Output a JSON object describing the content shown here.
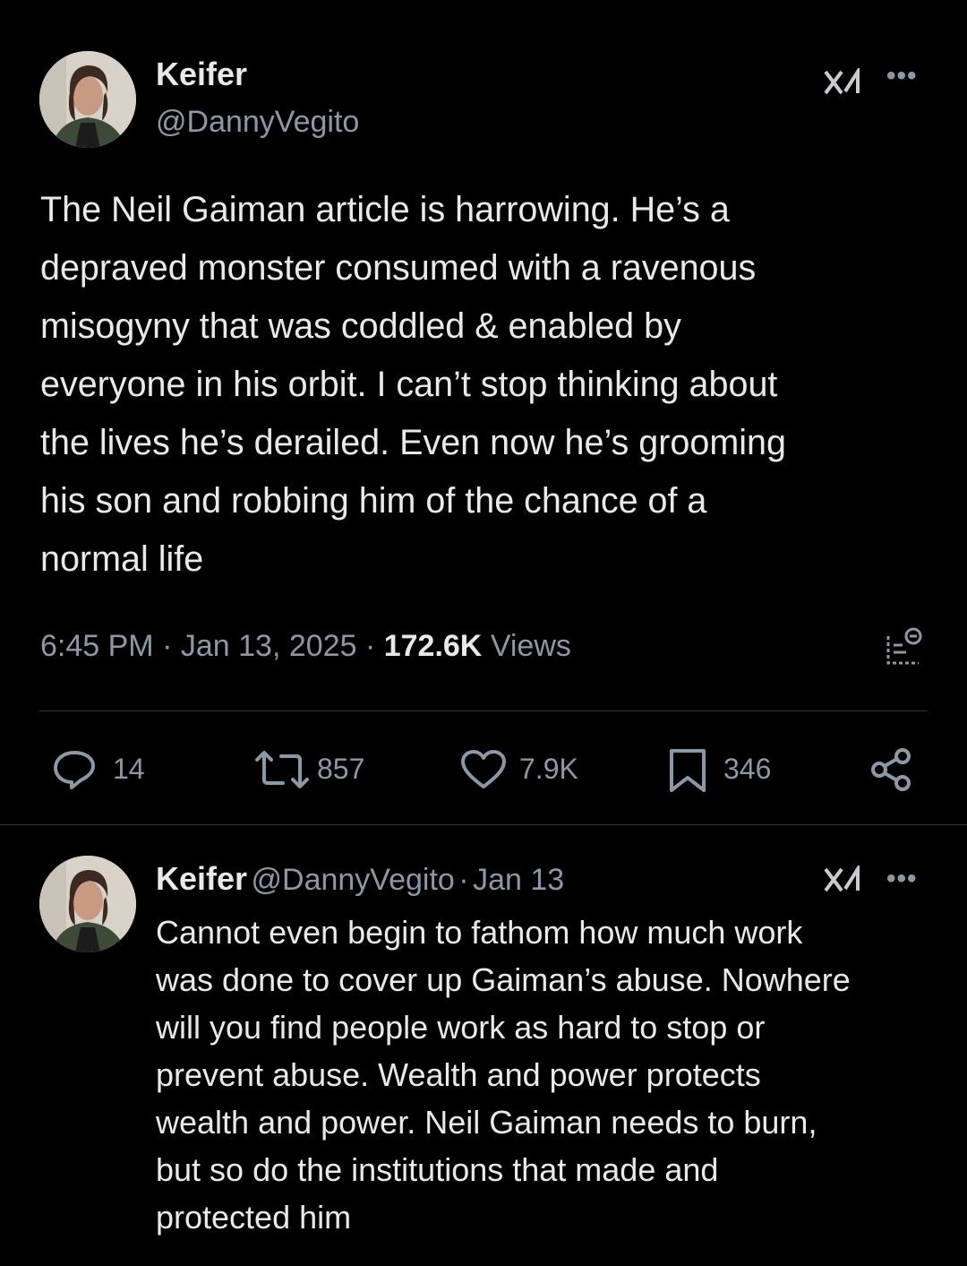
{
  "tweet": {
    "author_name": "Keifer",
    "author_handle": "@DannyVegito",
    "text": "The Neil Gaiman article is harrowing. He’s a\ndepraved monster consumed with a ravenous\nmisogyny that was coddled & enabled by\neveryone in his orbit. I can’t stop thinking about\nthe lives he’s derailed. Even now he’s grooming\nhis son and robbing him of the chance of a\nnormal life",
    "time": "6:45 PM",
    "date": "Jan 13, 2025",
    "views_count": "172.6K",
    "views_label": "Views",
    "separator": "·",
    "stats": {
      "replies": "14",
      "retweets": "857",
      "likes": "7.9K",
      "bookmarks": "346"
    }
  },
  "reply": {
    "author_name": "Keifer",
    "author_handle": "@DannyVegito",
    "separator": "·",
    "date": "Jan 13",
    "text": "Cannot even begin to fathom how much work\nwas done to cover up Gaiman’s abuse. Nowhere\nwill you find people work as hard to stop or\nprevent abuse. Wealth and power protects\nwealth and power. Neil Gaiman needs to burn,\nbut so do the institutions that made and\nprotected him"
  },
  "icons": {
    "more": "more-icon",
    "grok": "grok-icon",
    "reply": "reply-icon",
    "retweet": "retweet-icon",
    "like": "heart-icon",
    "bookmark": "bookmark-icon",
    "share": "share-icon",
    "analytics": "analytics-icon"
  },
  "colors": {
    "background": "#000000",
    "text": "#e7e9ea",
    "secondary": "#8b98a5",
    "divider": "#2f3336"
  }
}
